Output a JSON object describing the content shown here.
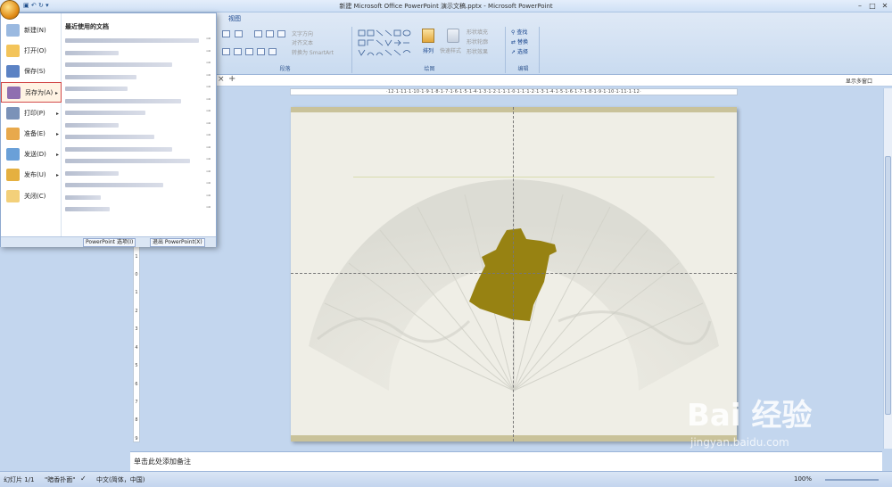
{
  "window": {
    "title": "新建 Microsoft Office PowerPoint 演示文稿.pptx - Microsoft PowerPoint",
    "min": "–",
    "max": "□",
    "close": "✕"
  },
  "ribbon": {
    "view_tab": "视图",
    "paragraph": {
      "label": "段落",
      "text_direction": "文字方向",
      "align_text": "对齐文本",
      "convert_smartart": "转换为 SmartArt"
    },
    "drawing": {
      "label": "绘图",
      "arrange": "排列",
      "quick_styles": "快速样式",
      "shape_fill": "形状填充",
      "shape_outline": "形状轮廓",
      "shape_effects": "形状效果"
    },
    "editing": {
      "label": "编辑",
      "find": "查找",
      "replace": "替换",
      "select": "选择"
    }
  },
  "tabbar": {
    "close": "×",
    "add": "+",
    "show_multi_window": "显示多窗口"
  },
  "ruler": {
    "h_ticks": "·12·1·11·1·10·1·9·1·8·1·7·1·6·1·5·1·4·1·3·1·2·1·1·1·0·1·1·1·2·1·3·1·4·1·5·1·6·1·7·1·8·1·9·1·10·1·11·1·12·",
    "v_ticks": [
      "9",
      "8",
      "7",
      "6",
      "5",
      "4",
      "3",
      "2",
      "1",
      "0",
      "1",
      "2",
      "3",
      "4",
      "5",
      "6",
      "7",
      "8",
      "9"
    ]
  },
  "notes": {
    "placeholder": "单击此处添加备注"
  },
  "status": {
    "slide": "幻灯片 1/1",
    "theme": "\"暗香扑面\"",
    "language": "中文(简体，中国)",
    "zoom": "100%"
  },
  "office_menu": {
    "items": [
      {
        "label": "新建(N)",
        "has_arrow": false
      },
      {
        "label": "打开(O)",
        "has_arrow": false
      },
      {
        "label": "保存(S)",
        "has_arrow": false
      },
      {
        "label": "另存为(A)",
        "has_arrow": true
      },
      {
        "label": "打印(P)",
        "has_arrow": true
      },
      {
        "label": "准备(E)",
        "has_arrow": true
      },
      {
        "label": "发送(D)",
        "has_arrow": true
      },
      {
        "label": "发布(U)",
        "has_arrow": true
      },
      {
        "label": "关闭(C)",
        "has_arrow": false
      }
    ],
    "recent_title": "最近使用的文档",
    "options_button": "PowerPoint 选项(I)",
    "exit_button": "退出 PowerPoint(X)"
  },
  "watermark": {
    "logo": "Bai 经验",
    "url": "jingyan.baidu.com"
  },
  "colors": {
    "accent": "#15428b",
    "background": "#c3d6ee",
    "slide_shape": "#978212",
    "slide_band": "#c9c29a"
  }
}
